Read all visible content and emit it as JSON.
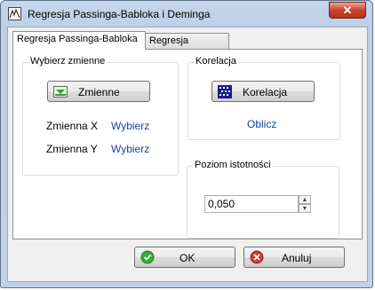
{
  "window": {
    "title": "Regresja Passinga-Babloka i Deminga",
    "close_label": "✕"
  },
  "tabs": [
    {
      "label": "Regresja Passinga-Babloka",
      "active": true
    },
    {
      "label": "Regresja Deminga",
      "active": false
    }
  ],
  "variables": {
    "group_title": "Wybierz zmienne",
    "button_label": "Zmienne",
    "x_label": "Zmienna X",
    "x_value": "Wybierz",
    "y_label": "Zmienna Y",
    "y_value": "Wybierz"
  },
  "correlation": {
    "group_title": "Korelacja",
    "button_label": "Korelacja",
    "link_label": "Oblicz"
  },
  "significance": {
    "group_title": "Poziom istotności",
    "value": "0,050"
  },
  "footer": {
    "ok_label": "OK",
    "cancel_label": "Anuluj"
  },
  "colors": {
    "link": "#1a3fa8",
    "ok_icon": "#3aa83a",
    "cancel_icon": "#d23a2a"
  }
}
